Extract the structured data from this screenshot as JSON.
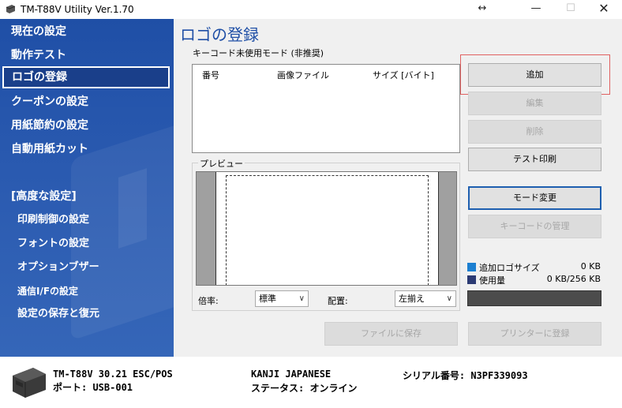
{
  "window": {
    "title": "TM-T88V Utility Ver.1.70",
    "resize_glyph": "↔",
    "minimize_glyph": "—",
    "maximize_glyph": "☐",
    "close_glyph": "✕"
  },
  "sidebar": {
    "items": [
      {
        "label": "現在の設定"
      },
      {
        "label": "動作テスト"
      },
      {
        "label": "ロゴの登録"
      },
      {
        "label": "クーポンの設定"
      },
      {
        "label": "用紙節約の設定"
      },
      {
        "label": "自動用紙カット"
      },
      {
        "label": "[高度な設定]"
      },
      {
        "label": "印刷制御の設定"
      },
      {
        "label": "フォントの設定"
      },
      {
        "label": "オプションブザー"
      },
      {
        "label": "通信I/Fの設定"
      },
      {
        "label": "設定の保存と復元"
      }
    ],
    "selected": "ロゴの登録"
  },
  "main": {
    "title": "ロゴの登録",
    "mode_label": "キーコード未使用モード (非推奨)",
    "list": {
      "columns": [
        "番号",
        "画像ファイル",
        "サイズ [バイト]"
      ]
    },
    "preview_label": "プレビュー",
    "scale_label": "倍率:",
    "scale_value": "標準",
    "layout_label": "配置:",
    "layout_value": "左揃え",
    "buttons": {
      "add": "追加",
      "edit": "編集",
      "delete": "削除",
      "test_print": "テスト印刷",
      "mode_change": "モード変更",
      "keycode_manage": "キーコードの管理",
      "save_file": "ファイルに保存",
      "register_printer": "プリンターに登録"
    },
    "legend": {
      "added_logo_label": "追加ロゴサイズ",
      "added_logo_value": "0 KB",
      "used_label": "使用量",
      "used_value": "0 KB/256 KB",
      "added_color": "#1c7fd1",
      "used_color": "#2b3a73"
    }
  },
  "status": {
    "model": "TM-T88V 30.21 ESC/POS",
    "port": "ポート: USB-001",
    "font": "KANJI JAPANESE",
    "state": "ステータス: オンライン",
    "serial": "シリアル番号: N3PF339093"
  },
  "colors": {
    "sidebar": "#2a5ab0",
    "title_accent": "#1f4fa6",
    "highlight": "#e06060"
  }
}
